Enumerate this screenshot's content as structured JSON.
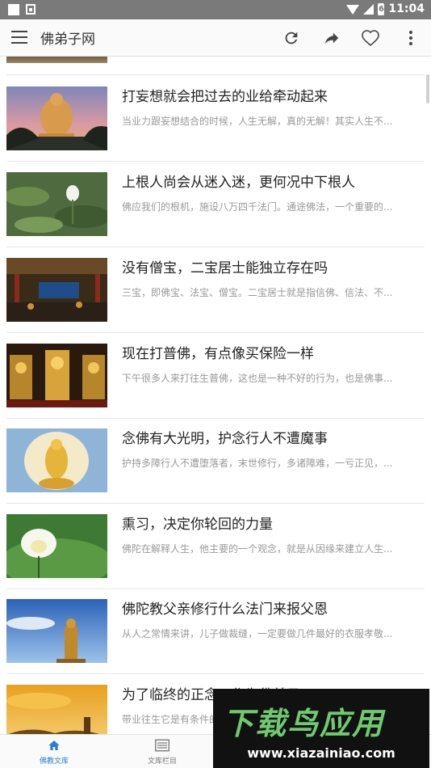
{
  "status_bar": {
    "time": "11:04",
    "battery_glyph": "6"
  },
  "app_bar": {
    "title": "佛弟子网"
  },
  "articles": [
    {
      "title": "打妄想就会把过去的业给牵动起来",
      "desc": "当业力跟妄想结合的时候，人生无解，真的无解！其实人生不..."
    },
    {
      "title": "上根人尚会从迷入迷，更何况中下根人",
      "desc": "佛应我们的根机，施设八万四千法门。通途佛法，一个重要的..."
    },
    {
      "title": "没有僧宝，二宝居士能独立存在吗",
      "desc": "三宝，即佛宝、法宝、僧宝。二宝居士就是指信佛、信法、不..."
    },
    {
      "title": "现在打普佛，有点像买保险一样",
      "desc": "下午很多人来打往生普佛，这也是一种不好的行为，也是佛事..."
    },
    {
      "title": "念佛有大光明，护念行人不遭魔事",
      "desc": "护持多障行人不遭堕落者，末世修行，多诸障难，一亏正见，..."
    },
    {
      "title": "熏习，决定你轮回的力量",
      "desc": "佛陀在解释人生，他主要的一个观念，就是从因缘来建立人生..."
    },
    {
      "title": "佛陀教父亲修行什么法门来报父恩",
      "desc": "从人之常情来讲，儿子做裁缝，一定要做几件最好的衣服孝敬..."
    },
    {
      "title": "为了临终的正念，作为佛弟子",
      "desc": "带业往生它是有条件的"
    }
  ],
  "bottom_nav": [
    {
      "label": "佛教文库"
    },
    {
      "label": "文库栏目"
    }
  ],
  "watermark": {
    "text": "下载鸟应用",
    "url": "www.xiazainiao.com"
  }
}
